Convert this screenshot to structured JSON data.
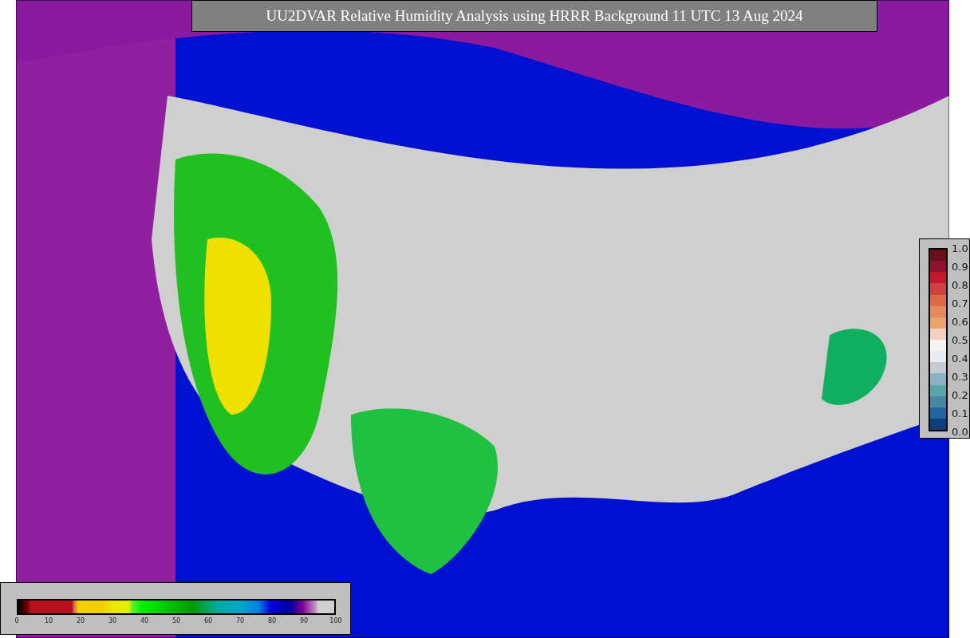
{
  "title": "UU2DVAR Relative Humidity Analysis using HRRR Background 11 UTC 13 Aug 2024",
  "humidity_colorbar": {
    "ticks": [
      "0",
      "10",
      "20",
      "30",
      "40",
      "50",
      "60",
      "70",
      "80",
      "90",
      "100"
    ]
  },
  "observation_colorbar": {
    "ticks": [
      "1.0",
      "0.9",
      "0.8",
      "0.7",
      "0.6",
      "0.5",
      "0.4",
      "0.3",
      "0.2",
      "0.1",
      "0.0"
    ]
  }
}
